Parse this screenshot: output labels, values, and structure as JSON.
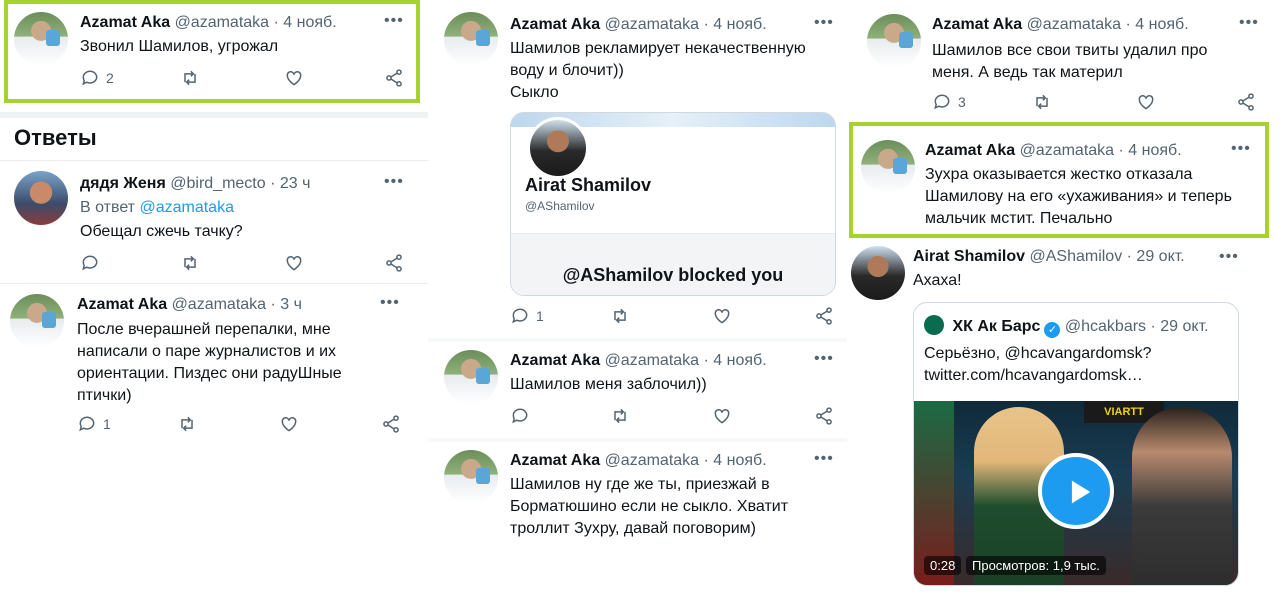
{
  "col1": {
    "tweet1": {
      "name": "Azamat Aka",
      "handle": "@azamataka",
      "time": "· 4 нояб.",
      "more": "•••",
      "text": "Звонил Шамилов, угрожал",
      "replies": "2"
    },
    "section_title": "Ответы",
    "tweet2": {
      "name": "дядя Женя",
      "handle": "@bird_mecto",
      "time": "· 23 ч",
      "more": "•••",
      "reply_prefix": "В ответ",
      "reply_handle": "@azamataka",
      "text": "Обещал сжечь тачку?"
    },
    "tweet3": {
      "name": "Azamat Aka",
      "handle": "@azamataka",
      "time": "· 3 ч",
      "more": "•••",
      "text_lines": [
        "После вчерашней перепалки, мне",
        "написали о паре журналистов и их",
        "ориентации. Пиздес они радуШные",
        "птички)"
      ],
      "replies": "1"
    }
  },
  "col2": {
    "tweet1": {
      "name": "Azamat Aka",
      "handle": "@azamataka",
      "time": "· 4 нояб.",
      "more": "•••",
      "text_lines": [
        "Шамилов рекламирует некачественную",
        "воду и блочит))",
        "Сыкло"
      ],
      "replies": "1",
      "card": {
        "profile_name": "Airat Shamilov",
        "profile_handle": "@AShamilov",
        "blocked_text": "@AShamilov blocked you"
      }
    },
    "tweet2": {
      "name": "Azamat Aka",
      "handle": "@azamataka",
      "time": "· 4 нояб.",
      "more": "•••",
      "text": "Шамилов меня заблочил))"
    },
    "tweet3": {
      "name": "Azamat Aka",
      "handle": "@azamataka",
      "time": "· 4 нояб.",
      "more": "•••",
      "text_lines": [
        "Шамилов ну где же ты, приезжай в",
        "Борматюшино если не сыкло. Хватит",
        "троллит Зухру, давай поговорим)"
      ]
    }
  },
  "col3": {
    "tweet1": {
      "name": "Azamat Aka",
      "handle": "@azamataka",
      "time": "· 4 нояб.",
      "more": "•••",
      "text_lines": [
        "Шамилов все свои твиты удалил про",
        "меня. А ведь так материл"
      ],
      "replies": "3"
    },
    "tweet2": {
      "name": "Azamat Aka",
      "handle": "@azamataka",
      "time": "· 4 нояб.",
      "more": "•••",
      "text_lines": [
        "Зухра оказывается жестко отказала",
        "Шамилову на его «ухаживания» и теперь",
        "мальчик мстит. Печально"
      ]
    },
    "tweet3": {
      "name": "Airat Shamilov",
      "handle": "@AShamilov",
      "time": "· 29 окт.",
      "more": "•••",
      "text": "Ахаха!",
      "quote": {
        "name": "ХК Ак Барс",
        "verified": "✓",
        "handle": "@hcakbars",
        "time": "· 29 окт.",
        "text_lines": [
          "Серьёзно, @hcavangardomsk?",
          "twitter.com/hcavangardomsk…"
        ],
        "video_time": "0:28",
        "video_views": "Просмотров: 1,9 тыс.",
        "score_logo": "VIARTT"
      }
    }
  },
  "colors": {
    "accent": "#1d9bf0",
    "highlight": "#a6d22f",
    "muted": "#536471"
  }
}
